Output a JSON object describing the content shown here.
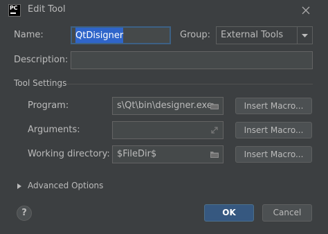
{
  "window": {
    "title": "Edit Tool",
    "app_icon_text": "PC",
    "accent_color": "#365880",
    "selection_color": "#2f65ca"
  },
  "form": {
    "name_label": "Name:",
    "name_value": "QtDisigner",
    "group_label": "Group:",
    "group_value": "External Tools",
    "description_label": "Description:",
    "description_value": ""
  },
  "tool_settings": {
    "section_title": "Tool Settings",
    "program_label": "Program:",
    "program_value": "s\\Qt\\bin\\designer.exe",
    "arguments_label": "Arguments:",
    "arguments_value": "",
    "working_dir_label": "Working directory:",
    "working_dir_value": "$FileDir$",
    "insert_macro_label": "Insert Macro..."
  },
  "advanced": {
    "label": "Advanced Options",
    "expanded": false
  },
  "footer": {
    "help_label": "?",
    "ok_label": "OK",
    "cancel_label": "Cancel"
  },
  "icons": {
    "close": "close-icon",
    "folder": "folder-icon",
    "expand": "expand-icon",
    "dropdown": "chevron-down-icon",
    "disclosure": "triangle-right-icon"
  }
}
